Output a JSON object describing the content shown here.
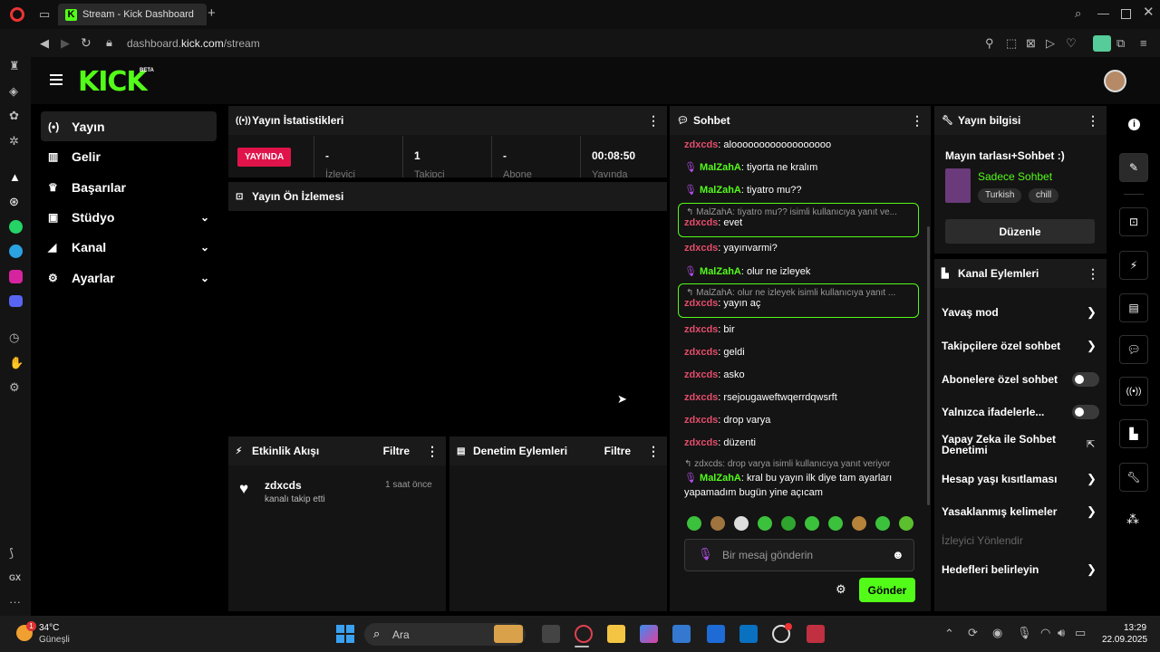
{
  "browser": {
    "tab_title": "Stream - Kick Dashboard",
    "url_prefix": "dashboard.",
    "url_domain": "kick.com",
    "url_path": "/stream"
  },
  "header": {
    "logo": "KICK",
    "beta": "BETA"
  },
  "nav": {
    "items": [
      {
        "label": "Yayın",
        "icon": "broadcast-icon"
      },
      {
        "label": "Gelir",
        "icon": "revenue-icon"
      },
      {
        "label": "Başarılar",
        "icon": "trophy-icon"
      },
      {
        "label": "Stüdyo",
        "icon": "studio-icon"
      },
      {
        "label": "Kanal",
        "icon": "channel-icon"
      },
      {
        "label": "Ayarlar",
        "icon": "gear-icon"
      }
    ]
  },
  "stats": {
    "title": "Yayın İstatistikleri",
    "status": "YAYINDA",
    "viewers_value": "-",
    "viewers_label": "İzleyici",
    "followers_value": "1",
    "followers_label": "Takipçi",
    "subs_value": "-",
    "subs_label": "Abone",
    "time_value": "00:08:50",
    "time_label": "Yayında"
  },
  "preview": {
    "title": "Yayın Ön İzlemesi"
  },
  "activity": {
    "title": "Etkinlik Akışı",
    "filter": "Filtre",
    "item_user": "zdxcds",
    "item_time": "1 saat önce",
    "item_text": "kanalı takip etti"
  },
  "moderation": {
    "title": "Denetim Eylemleri",
    "filter": "Filtre"
  },
  "chat": {
    "title": "Sohbet",
    "messages": [
      {
        "user": "zdxcds",
        "text": "aloooooooooooooooooo"
      },
      {
        "user": "MalZahA",
        "text": "tiyorta ne kralım"
      },
      {
        "user": "MalZahA",
        "text": "tiyatro mu??"
      },
      {
        "reply": "MalZahA: tiyatro mu?? isimli kullanıcıya yanıt ve...",
        "user": "zdxcds",
        "text": "evet"
      },
      {
        "user": "zdxcds",
        "text": "yayınvarmi?"
      },
      {
        "user": "MalZahA",
        "text": "olur ne izleyek"
      },
      {
        "reply": "MalZahA: olur ne izleyek isimli kullanıcıya yanıt ...",
        "user": "zdxcds",
        "text": "yayın aç"
      },
      {
        "user": "zdxcds",
        "text": "bir"
      },
      {
        "user": "zdxcds",
        "text": "geldi"
      },
      {
        "user": "zdxcds",
        "text": "asko"
      },
      {
        "user": "zdxcds",
        "text": "rsejougaweftwqerrdqwsrft"
      },
      {
        "user": "zdxcds",
        "text": "drop varya"
      },
      {
        "user": "zdxcds",
        "text": "düzenti"
      },
      {
        "reply": "zdxcds: drop varya isimli kullanıcıya yanıt veriyor",
        "user": "MalZahA",
        "text": "kral bu yayın ilk diye tam ayarları",
        "text2": "yapamadım bugün yine açıcam"
      }
    ],
    "placeholder": "Bir mesaj gönderin",
    "send": "Gönder"
  },
  "info": {
    "title": "Yayın bilgisi",
    "stream_title": "Mayın tarlası+Sohbet :)",
    "category": "Sadece Sohbet",
    "tag1": "Turkish",
    "tag2": "chill",
    "edit": "Düzenle"
  },
  "channel_actions": {
    "title": "Kanal Eylemleri",
    "slow": "Yavaş mod",
    "followers_only": "Takipçilere özel sohbet",
    "subs_only": "Abonelere özel sohbet",
    "emotes_only": "Yalnızca ifadelerle...",
    "ai_mod_1": "Yapay Zeka ile Sohbet",
    "ai_mod_2": "Denetimi",
    "age": "Hesap yaşı kısıtlaması",
    "banned": "Yasaklanmış kelimeler",
    "redirect": "İzleyici Yönlendir",
    "goals": "Hedefleri belirleyin"
  },
  "taskbar": {
    "weather_temp": "34°C",
    "weather_text": "Güneşli",
    "badge": "1",
    "search": "Ara",
    "time": "13:29",
    "date": "22.09.2025"
  },
  "colors": {
    "accent": "#53fc18",
    "user_red": "#e34d6b",
    "live": "#e0144a"
  }
}
